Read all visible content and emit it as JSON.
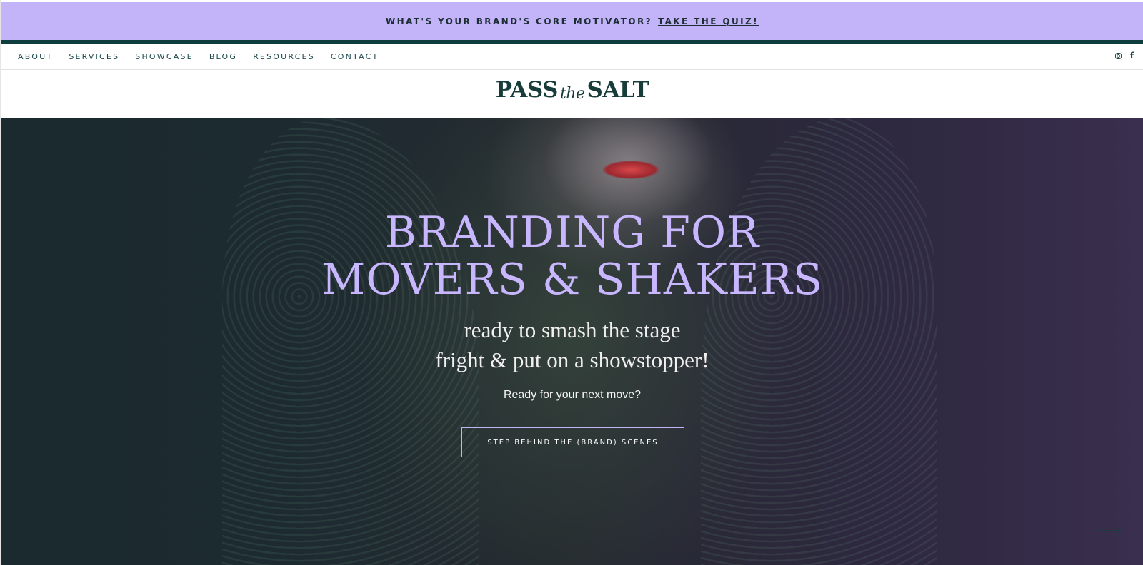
{
  "announcement": {
    "text": "WHAT'S YOUR BRAND'S CORE MOTIVATOR?",
    "link": "TAKE THE QUIZ!"
  },
  "nav": {
    "items": [
      "ABOUT",
      "SERVICES",
      "SHOWCASE",
      "BLOG",
      "RESOURCES",
      "CONTACT"
    ],
    "social": {
      "facebook_label": "f"
    }
  },
  "logo": {
    "left": "PASS",
    "middle": "the",
    "right": "SALT"
  },
  "hero": {
    "headline_1": "BRANDING FOR",
    "headline_2": "MOVERS & SHAKERS",
    "subline_1": "ready to smash the stage",
    "subline_2": "fright & put on a showstopper!",
    "prompt": "Ready for your next move?",
    "cta": "STEP BEHIND THE (BRAND) SCENES"
  },
  "colors": {
    "accent": "#c3b4fa",
    "brand_dark": "#0e3d3d",
    "headline": "#c8b6ff"
  },
  "icons": [
    "instagram-icon",
    "facebook-icon",
    "arrow-right-icon"
  ]
}
